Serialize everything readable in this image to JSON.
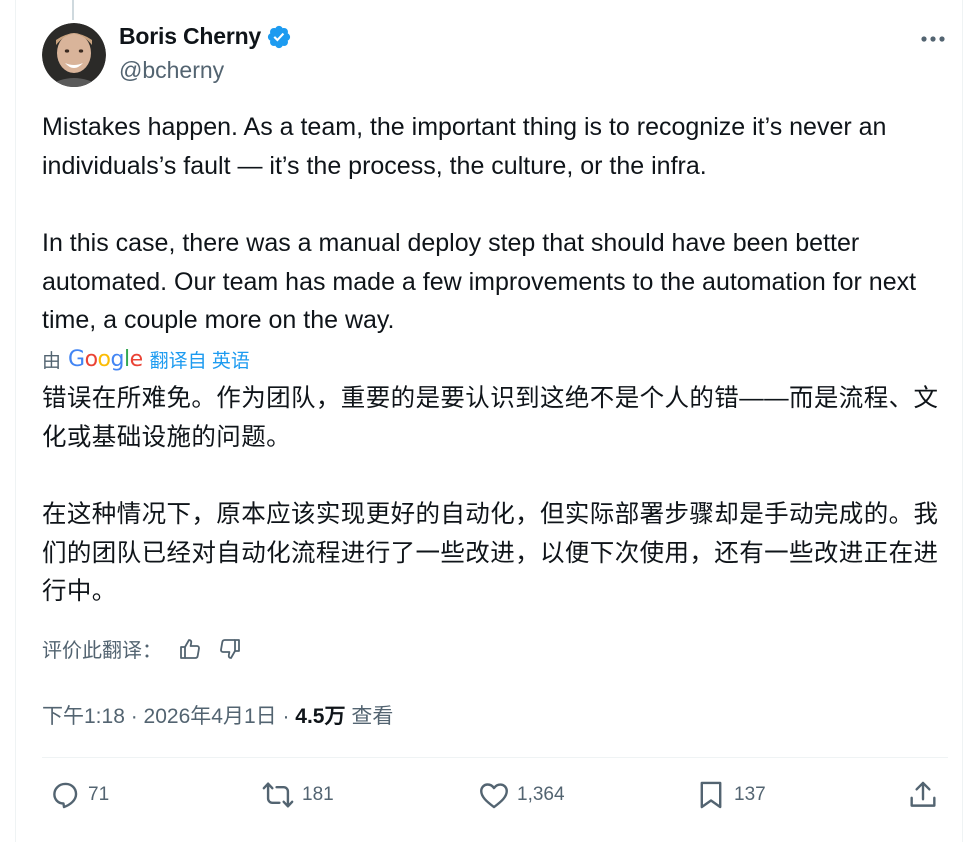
{
  "author": {
    "display_name": "Boris Cherny",
    "handle": "@bcherny",
    "verified_icon": "verified-badge-icon",
    "verified_color": "#1d9bf0"
  },
  "tweet": {
    "paragraph_1": "Mistakes happen. As a team, the important thing is to recognize it’s never an individuals’s fault — it’s the process, the culture, or the infra.",
    "paragraph_2": "In this case, there was a manual deploy step that should have been better automated. Our team has made a few improvements to the automation for next time, a couple more on the way."
  },
  "translation": {
    "by_label": "由",
    "provider_logo": "Google",
    "translated_from_label": "翻译自 英语",
    "paragraph_1": "错误在所难免。作为团队，重要的是要认识到这绝不是个人的错——而是流程、文化或基础设施的问题。",
    "paragraph_2": "在这种情况下，原本应该实现更好的自动化，但实际部署步骤却是手动完成的。我们的团队已经对自动化流程进行了一些改进，以便下次使用，还有一些改进正在进行中。",
    "rate_label": "评价此翻译：",
    "thumbs_up_icon": "thumbs-up-icon",
    "thumbs_down_icon": "thumbs-down-icon"
  },
  "meta": {
    "time": "下午1:18",
    "separator": " · ",
    "date": "2026年4月1日",
    "views_count": "4.5万",
    "views_label": "查看"
  },
  "actions": {
    "reply_count": "71",
    "repost_count": "181",
    "like_count": "1,364",
    "bookmark_count": "137",
    "icons": [
      "reply-icon",
      "repost-icon",
      "like-icon",
      "bookmark-icon",
      "share-icon"
    ]
  },
  "colors": {
    "accent": "#1d9bf0",
    "text": "#0f1419",
    "secondary_text": "#536471",
    "border": "#eff3f4"
  }
}
